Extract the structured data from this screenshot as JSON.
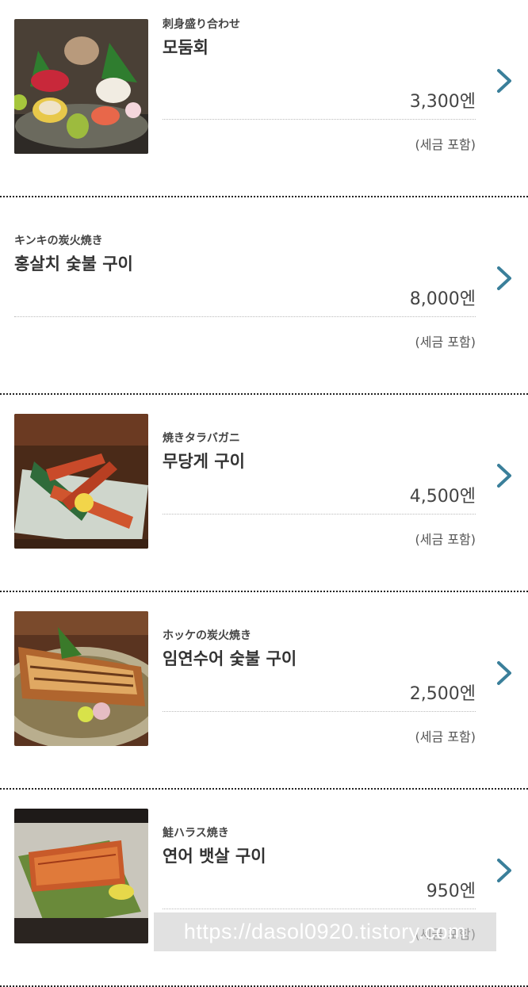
{
  "items": [
    {
      "jp": "刺身盛り合わせ",
      "kr": "모둠회",
      "price": "3,300엔",
      "tax": "(세금 포함)",
      "image": "sashimi-platter"
    },
    {
      "jp": "キンキの炭火焼き",
      "kr": "홍살치 숯불 구이",
      "price": "8,000엔",
      "tax": "(세금 포함)",
      "image": null
    },
    {
      "jp": "焼きタラバガニ",
      "kr": "무당게 구이",
      "price": "4,500엔",
      "tax": "(세금 포함)",
      "image": "grilled-king-crab"
    },
    {
      "jp": "ホッケの炭火焼き",
      "kr": "임연수어 숯불 구이",
      "price": "2,500엔",
      "tax": "(세금 포함)",
      "image": "grilled-atka-mackerel"
    },
    {
      "jp": "鮭ハラス焼き",
      "kr": "연어 뱃살 구이",
      "price": "950엔",
      "tax": "(세금 포함)",
      "image": "grilled-salmon-belly"
    }
  ],
  "icons": {
    "chevron": "chevron-right-icon"
  },
  "colors": {
    "chevron": "#3a7f9a",
    "divider": "#222222"
  },
  "watermark": "https://dasol0920.tistory.com"
}
